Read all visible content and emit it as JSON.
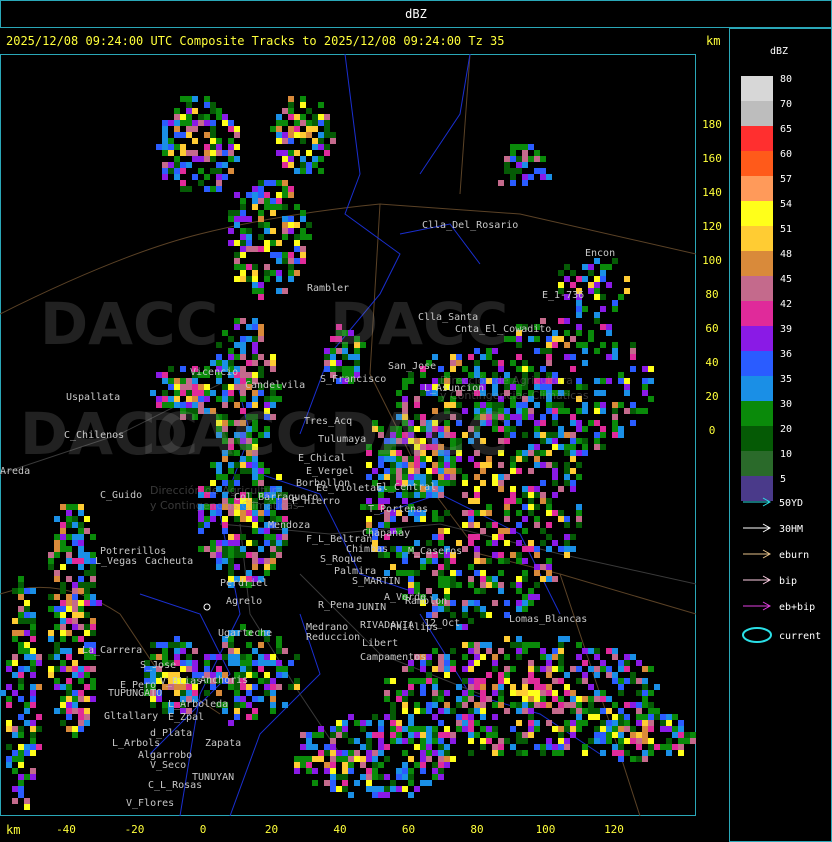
{
  "title": "dBZ",
  "header": "2025/12/08 09:24:00 UTC Composite Tracks to 2025/12/08 09:24:00 Tz 35",
  "km_label": "km",
  "legend_title": "dBZ",
  "colorbar": [
    {
      "label": "80",
      "color": "#d7d7d7"
    },
    {
      "label": "70",
      "color": "#bdbdbd"
    },
    {
      "label": "65",
      "color": "#ff2f2f"
    },
    {
      "label": "60",
      "color": "#ff5a1a"
    },
    {
      "label": "57",
      "color": "#ff9a5a"
    },
    {
      "label": "54",
      "color": "#ffff1a"
    },
    {
      "label": "51",
      "color": "#ffcc33"
    },
    {
      "label": "48",
      "color": "#d98a3a"
    },
    {
      "label": "45",
      "color": "#c46a8c"
    },
    {
      "label": "42",
      "color": "#e02a9a"
    },
    {
      "label": "39",
      "color": "#8a1ae6"
    },
    {
      "label": "36",
      "color": "#2a5cff"
    },
    {
      "label": "35",
      "color": "#1a8fe6"
    },
    {
      "label": "30",
      "color": "#0a8a0a"
    },
    {
      "label": "20",
      "color": "#055a05"
    },
    {
      "label": "10",
      "color": "#2a6a2a"
    },
    {
      "label": "5",
      "color": "#4a3a8a"
    }
  ],
  "tracks": [
    {
      "label": "50YD",
      "color": "#2adfe6",
      "icon": "arrow-right-icon"
    },
    {
      "label": "30HM",
      "color": "#ffffff",
      "icon": "arrow-right-icon"
    },
    {
      "label": "eburn",
      "color": "#e6c28a",
      "icon": "arrow-right-icon"
    },
    {
      "label": "bip",
      "color": "#ffd0e6",
      "icon": "arrow-right-icon"
    },
    {
      "label": "eb+bip",
      "color": "#e040e0",
      "icon": "arrow-right-icon"
    },
    {
      "label": "current",
      "color": "#2adfe6",
      "icon": "ellipse-icon"
    }
  ],
  "y_ticks": [
    "180",
    "160",
    "140",
    "120",
    "100",
    "80",
    "60",
    "40",
    "20",
    "0"
  ],
  "x_ticks": [
    "-40",
    "-20",
    "0",
    "20",
    "40",
    "60",
    "80",
    "100",
    "120"
  ],
  "places": [
    "Clla_Del_Rosario",
    "Encon",
    "E_1-736",
    "Rambler",
    "Clla_Santa",
    "Cnta_El_Cowadito",
    "Uspallata",
    "Vicencio",
    "Candelvila",
    "S_Francisco",
    "San_Jose",
    "L_Asuncion",
    "C_Chilenos",
    "Tres_Acq",
    "Tulumaya",
    "E_Chical",
    "E_Vergel",
    "Borbollon",
    "Ee_Violetas",
    "P_Hierro",
    "El_Central",
    "T_Portenas",
    "C_Guido",
    "Cacheuta",
    "Potrerillos",
    "L_Vegas",
    "Perdriel",
    "Agrelo",
    "Medrano",
    "Reduccion",
    "Chapanay",
    "M_Caseros",
    "S_MARTIN",
    "A_Verde",
    "Ramblon",
    "Lomas_Blancas",
    "RIVADAVIA",
    "Phillips",
    "12_Oct",
    "La_Carrera",
    "Ugarteche",
    "S_Jose",
    "E_Pero",
    "TUPUNGATO",
    "Anchoris",
    "V_Btias",
    "L_Arboleda",
    "Gltallary",
    "E_Zpal",
    "L_Arbols",
    "d_Plata",
    "Zapata",
    "Algarrobo",
    "V_Seco",
    "TUNUYAN",
    "C_L_Rosas",
    "V_Flores",
    "Chimbas",
    "S_Roque",
    "Palmira",
    "JUNIN",
    "R_Pena",
    "Libert",
    "Campamentos",
    "Mendoza",
    "F_L_Beltran",
    "Areda",
    "Col_Barraquero"
  ],
  "watermarks": [
    "DACC",
    "DACC",
    "DACC",
    "DACC",
    "DACC"
  ],
  "watermark_sub": [
    "Dirección de Agricultura",
    "y Contingencias Climáticas"
  ]
}
